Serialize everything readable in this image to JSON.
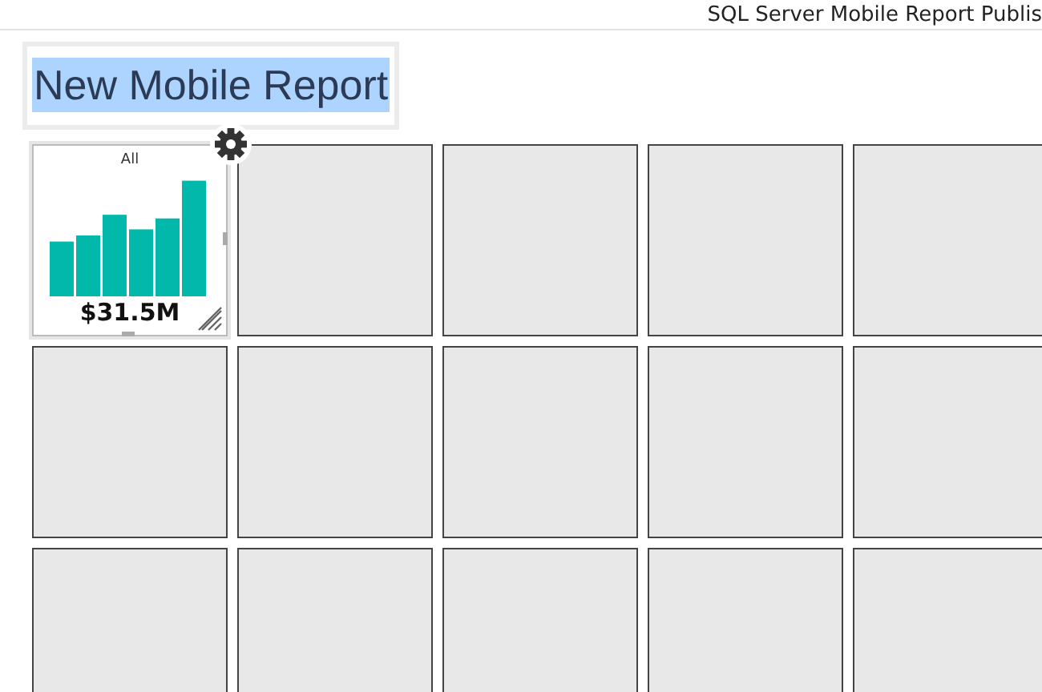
{
  "header": {
    "title": "SQL Server Mobile Report Publis"
  },
  "report_title": {
    "text": "New Mobile Report",
    "selected": true
  },
  "tiles": [
    {
      "kind": "chart",
      "filter": "All",
      "value": "$31.5M",
      "selected": true
    },
    {
      "kind": "empty"
    },
    {
      "kind": "empty"
    },
    {
      "kind": "empty"
    },
    {
      "kind": "empty"
    },
    {
      "kind": "empty"
    },
    {
      "kind": "empty"
    },
    {
      "kind": "empty"
    },
    {
      "kind": "empty"
    },
    {
      "kind": "empty"
    },
    {
      "kind": "empty"
    },
    {
      "kind": "empty"
    },
    {
      "kind": "empty"
    },
    {
      "kind": "empty"
    },
    {
      "kind": "empty"
    }
  ]
}
